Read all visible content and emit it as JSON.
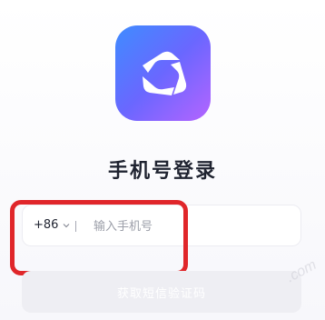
{
  "app": {
    "logo_icon": "app-logo-icon",
    "logo_colors": [
      "#3f8cff",
      "#6a67ff",
      "#b464ff"
    ]
  },
  "login": {
    "title": "手机号登录",
    "country_code": "+86",
    "phone_placeholder": "输入手机号",
    "submit_label": "获取短信验证码"
  },
  "annotation": {
    "highlight_color": "#e0262a"
  },
  "watermark": {
    "text": ".com"
  }
}
